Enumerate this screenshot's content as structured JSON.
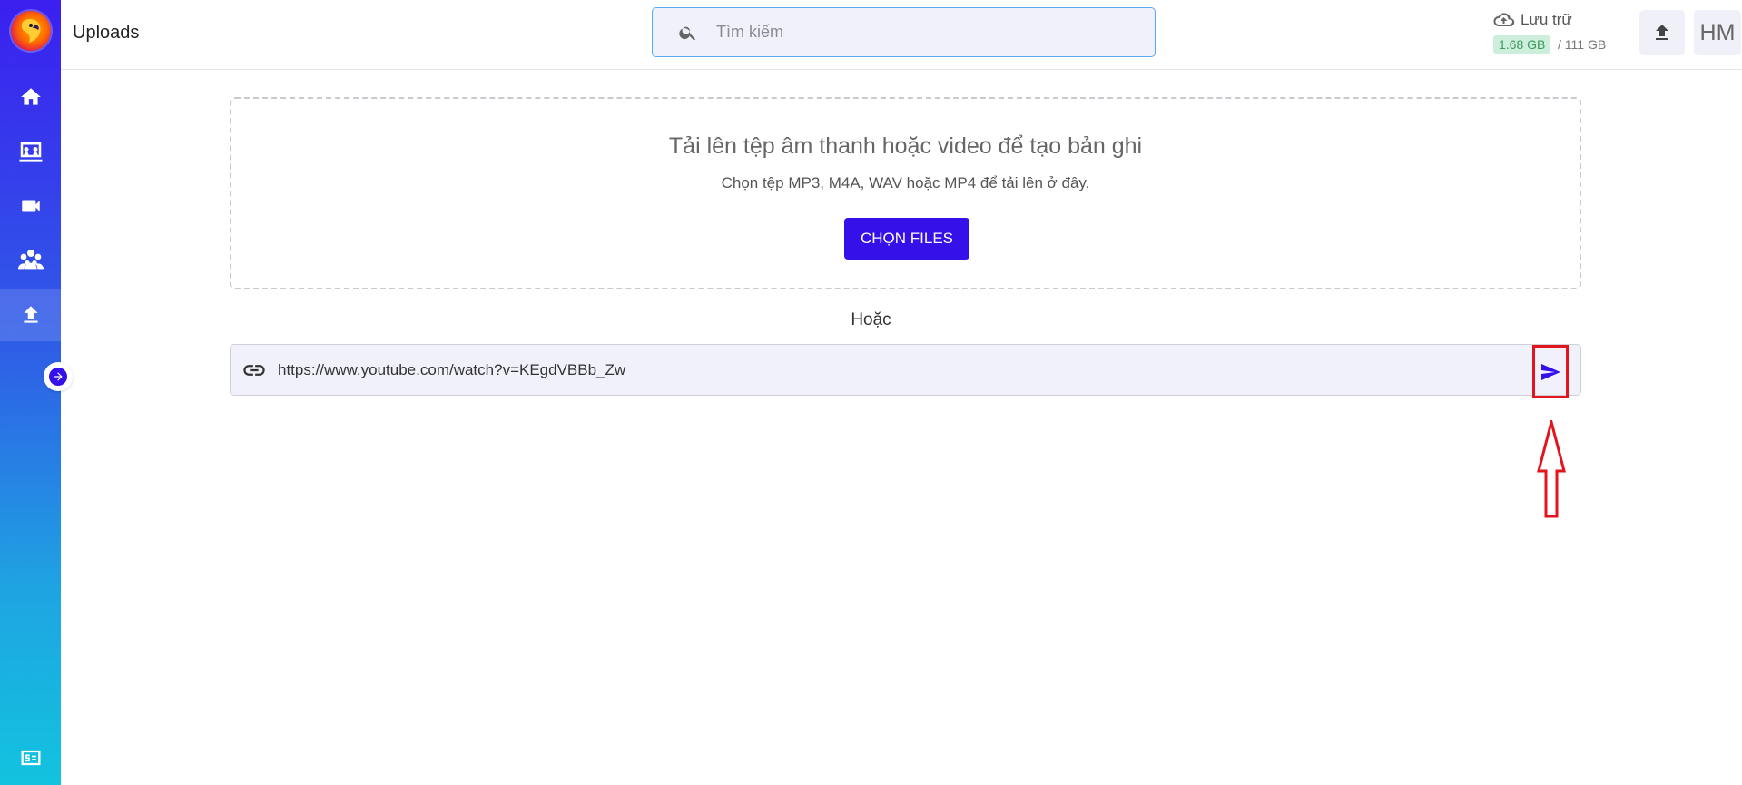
{
  "header": {
    "page_title": "Uploads",
    "search_placeholder": "Tìm kiếm",
    "storage_label": "Lưu trữ",
    "storage_used": "1.68 GB",
    "storage_total": "/ 111 GB",
    "avatar_initials": "HM"
  },
  "sidebar": {
    "items": [
      {
        "icon": "home-icon"
      },
      {
        "icon": "meetings-icon"
      },
      {
        "icon": "video-icon"
      },
      {
        "icon": "team-icon"
      },
      {
        "icon": "upload-icon",
        "active": true
      }
    ],
    "bottom_icon": "billing-icon"
  },
  "upload": {
    "title": "Tải lên tệp âm thanh hoặc video để tạo bản ghi",
    "subtitle": "Chọn tệp MP3, M4A, WAV hoặc MP4 để tải lên ở đây.",
    "button_label": "CHỌN FILES",
    "or_label": "Hoặc",
    "url_value": "https://www.youtube.com/watch?v=KEgdVBBb_Zw"
  },
  "colors": {
    "accent": "#3510e8",
    "highlight": "#e2141e",
    "storage_badge_bg": "#cdeedb"
  }
}
